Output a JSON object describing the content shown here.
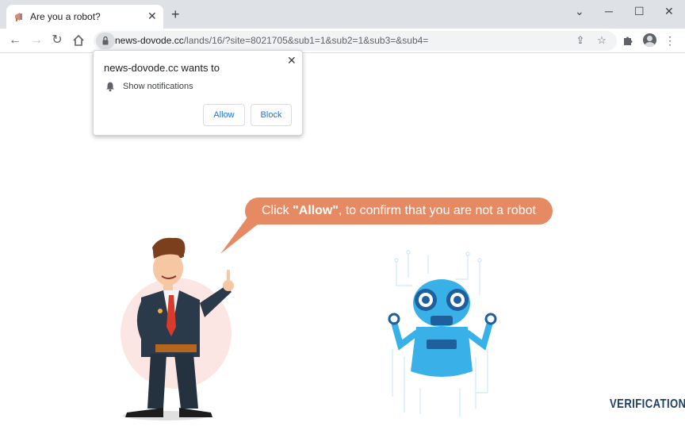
{
  "browser": {
    "tab_title": "Are you a robot?",
    "url_host": "news-dovode.cc",
    "url_path": "/lands/16/?site=8021705&sub1=1&sub2=1&sub3=&sub4="
  },
  "popup": {
    "title": "news-dovode.cc wants to",
    "permission": "Show notifications",
    "allow_label": "Allow",
    "block_label": "Block"
  },
  "page": {
    "bubble_prefix": "Click ",
    "bubble_bold": "\"Allow\"",
    "bubble_suffix": ", to confirm that you are not a robot",
    "verification_label": "VERIFICATION"
  },
  "colors": {
    "bubble": "#e58a63",
    "accent_blue": "#1a73e8",
    "robot_blue": "#3ab0e8",
    "verification": "#1e3f66"
  }
}
